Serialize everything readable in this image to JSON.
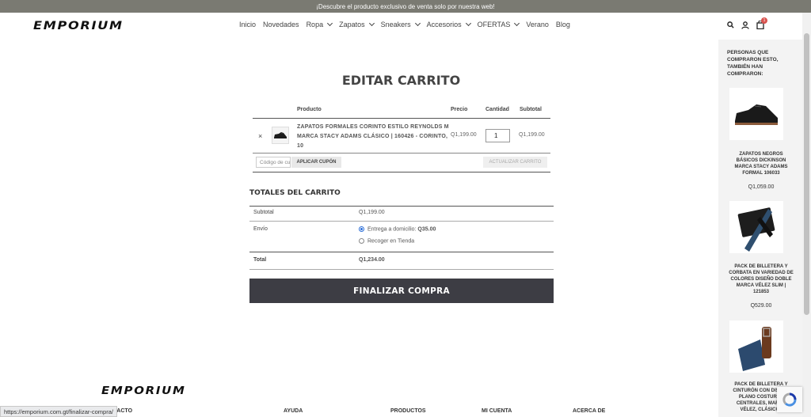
{
  "promo_bar": "¡Descubre el producto exclusivo de venta solo por nuestra web!",
  "header": {
    "logo": "EMPORIUM",
    "nav": [
      {
        "label": "Inicio",
        "has_dropdown": false
      },
      {
        "label": "Novedades",
        "has_dropdown": false
      },
      {
        "label": "Ropa",
        "has_dropdown": true
      },
      {
        "label": "Zapatos",
        "has_dropdown": true
      },
      {
        "label": "Sneakers",
        "has_dropdown": true
      },
      {
        "label": "Accesorios",
        "has_dropdown": true
      },
      {
        "label": "OFERTAS",
        "has_dropdown": true
      },
      {
        "label": "Verano",
        "has_dropdown": false
      },
      {
        "label": "Blog",
        "has_dropdown": false
      }
    ],
    "cart_count": "1"
  },
  "page_title": "EDITAR CARRITO",
  "cart": {
    "headers": {
      "product": "Producto",
      "price": "Precio",
      "quantity": "Cantidad",
      "subtotal": "Subtotal"
    },
    "item": {
      "remove": "×",
      "name": "ZAPATOS FORMALES CORINTO ESTILO REYNOLDS M MARCA STACY ADAMS CLÁSICO | 160426 - CORINTO, 10",
      "price": "Q1,199.00",
      "quantity": "1",
      "subtotal": "Q1,199.00"
    },
    "coupon_placeholder": "Código de cupón",
    "apply_coupon": "APLICAR CUPÓN",
    "update_cart": "ACTUALIZAR CARRITO"
  },
  "totals": {
    "title": "TOTALES DEL CARRITO",
    "subtotal_label": "Subtotal",
    "subtotal_value": "Q1,199.00",
    "shipping_label": "Envío",
    "shipping_option_1": "Entrega a domicilio: ",
    "shipping_option_1_price": "Q35.00",
    "shipping_option_2": "Recoger en Tienda",
    "total_label": "Total",
    "total_value": "Q1,234.00"
  },
  "checkout_button": "FINALIZAR COMPRA",
  "sidebar": {
    "title": "PERSONAS QUE COMPRARON ESTO, TAMBIÉN HAN COMPRARON:",
    "products": [
      {
        "name": "ZAPATOS NEGROS BÁSICOS DICKINSON MARCA STACY ADAMS FORMAL 106033",
        "price": "Q1,059.00"
      },
      {
        "name": "PACK DE BILLETERA Y CORBATA EN VARIEDAD DE COLORES DISEÑO DOBLE MARCA VÉLEZ SLIM | 121853",
        "price": "Q529.00"
      },
      {
        "name": "PACK DE BILLETERA Y CINTURÓN CON DISEÑO PLANO COSTURAS CENTRALES, MARCA VÉLEZ, CLÁSICO |",
        "price": ""
      }
    ]
  },
  "footer": {
    "logo": "EMPORIUM",
    "columns": [
      "CONTACTO",
      "AYUDA",
      "PRODUCTOS",
      "MI CUENTA",
      "ACERCA DE"
    ]
  },
  "status_url": "https://emporium.com.gt/finalizar-compra/",
  "colors": {
    "promo_bg": "#7a7a72",
    "checkout_bg": "#3d3d44",
    "badge": "#d9534f",
    "sidebar_bg": "#f3f3f3"
  }
}
